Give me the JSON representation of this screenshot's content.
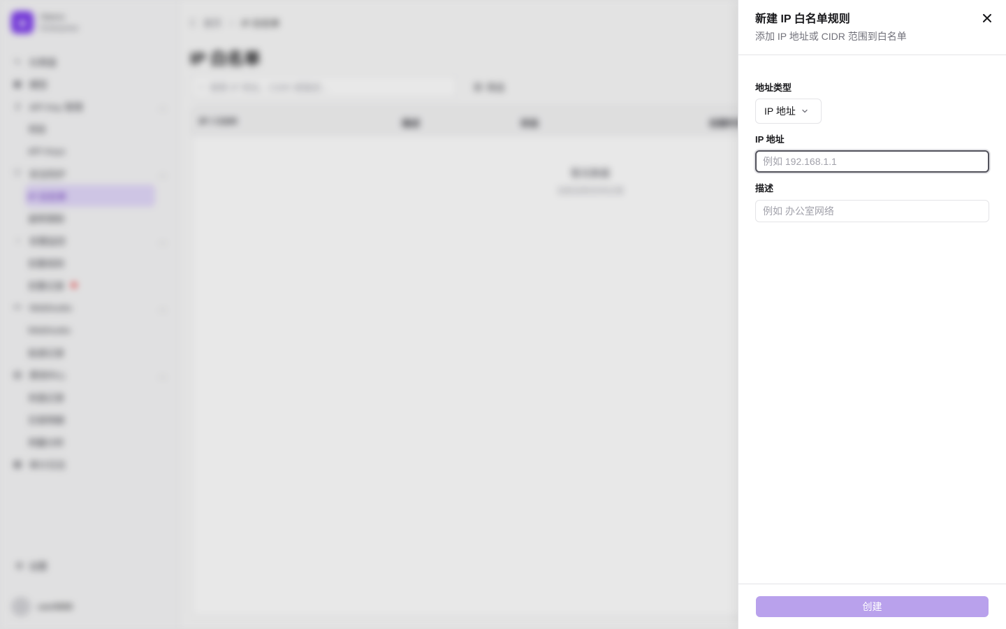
{
  "app": {
    "brand_name": "Hanco",
    "brand_sub": "Enterprise"
  },
  "sidebar": {
    "items": [
      {
        "label": "仪表盘",
        "icon": "activity-icon",
        "type": "top"
      },
      {
        "label": "模型",
        "icon": "cube-icon",
        "type": "top"
      },
      {
        "label": "API Key 管理",
        "icon": "key-icon",
        "type": "top",
        "expandable": true
      },
      {
        "label": "项目",
        "type": "sub"
      },
      {
        "label": "API Keys",
        "type": "sub"
      },
      {
        "label": "安全防护",
        "icon": "shield-icon",
        "type": "top",
        "expandable": true
      },
      {
        "label": "IP 白名单",
        "type": "sub",
        "active": true
      },
      {
        "label": "速率限制",
        "type": "sub"
      },
      {
        "label": "告警监控",
        "icon": "bell-icon",
        "type": "top",
        "expandable": true
      },
      {
        "label": "告警规则",
        "type": "sub"
      },
      {
        "label": "告警记录",
        "type": "sub",
        "badge": true
      },
      {
        "label": "Webhooks",
        "icon": "webhook-icon",
        "type": "top",
        "expandable": true
      },
      {
        "label": "Webhooks",
        "type": "sub"
      },
      {
        "label": "投递记录",
        "type": "sub"
      },
      {
        "label": "费用中心",
        "icon": "wallet-icon",
        "type": "top",
        "expandable": true
      },
      {
        "label": "充值记录",
        "type": "sub"
      },
      {
        "label": "交易明细",
        "type": "sub"
      },
      {
        "label": "用量分析",
        "type": "sub"
      },
      {
        "label": "审计日志",
        "icon": "log-icon",
        "type": "top"
      }
    ],
    "settings_label": "设置",
    "user_name": "user8888"
  },
  "main": {
    "breadcrumb_home": "首页",
    "breadcrumb_current": "IP 白名单",
    "page_title": "IP 白名单",
    "search_placeholder": "搜索 IP 地址、CIDR 或描述...",
    "filter_label": "筛选",
    "columns": [
      "IP / CIDR",
      "描述",
      "状态",
      "创建时间"
    ],
    "empty_title": "暂无数据",
    "empty_sub": "当前没有任何记录"
  },
  "drawer": {
    "title": "新建 IP 白名单规则",
    "description": "添加 IP 地址或 CIDR 范围到白名单",
    "address_type_label": "地址类型",
    "address_type_value": "IP 地址",
    "ip_label": "IP 地址",
    "ip_placeholder": "例如 192.168.1.1",
    "ip_value": "",
    "desc_label": "描述",
    "desc_placeholder": "例如 办公室网络",
    "desc_value": "",
    "create_label": "创建",
    "close_icon": "close-icon"
  },
  "colors": {
    "accent": "#7c3aed",
    "button_disabled": "#b9a1ec",
    "active_nav_bg": "#e3d9fb"
  }
}
